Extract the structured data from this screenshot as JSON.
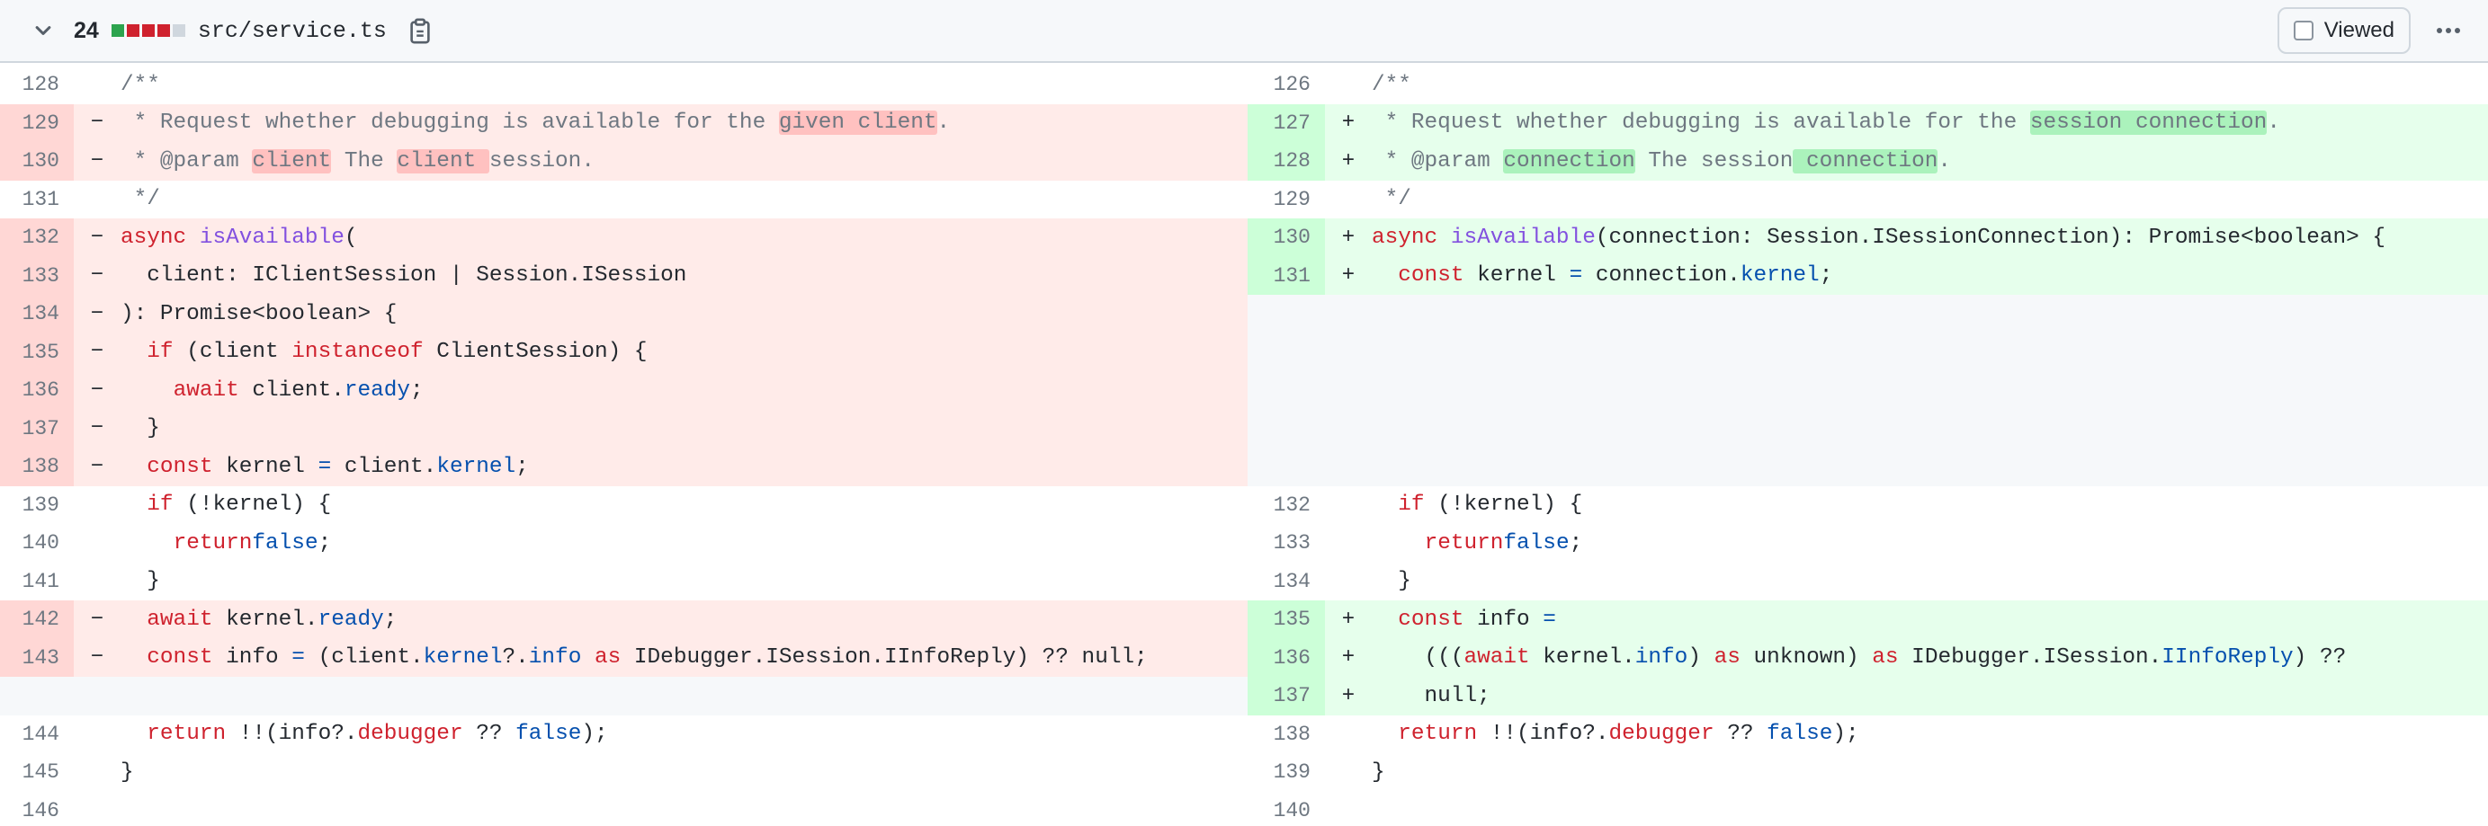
{
  "file": {
    "changes": "24",
    "name": "src/service.ts",
    "viewed_label": "Viewed",
    "blocks": [
      "#2da44e",
      "#cf222e",
      "#cf222e",
      "#cf222e",
      "#d0d7de"
    ]
  },
  "left": [
    {
      "n": "128",
      "t": "ctx",
      "s": [
        [
          "c",
          "/**"
        ]
      ]
    },
    {
      "n": "129",
      "t": "del",
      "m": "−",
      "s": [
        [
          "c",
          " * Request whether debugging is available for the "
        ],
        [
          "cd",
          "given client"
        ],
        [
          "c",
          "."
        ]
      ]
    },
    {
      "n": "130",
      "t": "del",
      "m": "−",
      "s": [
        [
          "c",
          " * @param "
        ],
        [
          "cd",
          "client"
        ],
        [
          "c",
          " The "
        ],
        [
          "cd",
          "client "
        ],
        [
          "c",
          "session."
        ]
      ]
    },
    {
      "n": "131",
      "t": "ctx",
      "s": [
        [
          "c",
          " */"
        ]
      ]
    },
    {
      "n": "132",
      "t": "del",
      "m": "−",
      "s": [
        [
          "k",
          "async "
        ],
        [
          "f",
          "isAvailable"
        ],
        [
          "",
          "("
        ]
      ]
    },
    {
      "n": "133",
      "t": "del",
      "m": "−",
      "s": [
        [
          "",
          "  client: IClientSession | Session.ISession"
        ]
      ]
    },
    {
      "n": "134",
      "t": "del",
      "m": "−",
      "s": [
        [
          "",
          "): Promise<boolean> {"
        ]
      ]
    },
    {
      "n": "135",
      "t": "del",
      "m": "−",
      "s": [
        [
          "",
          "  "
        ],
        [
          "k",
          "if"
        ],
        [
          "",
          " (client "
        ],
        [
          "k",
          "instanceof"
        ],
        [
          "",
          " ClientSession) {"
        ]
      ]
    },
    {
      "n": "136",
      "t": "del",
      "m": "−",
      "s": [
        [
          "",
          "    "
        ],
        [
          "k",
          "await"
        ],
        [
          "",
          " client."
        ],
        [
          "p",
          "ready"
        ],
        [
          "",
          ";"
        ]
      ]
    },
    {
      "n": "137",
      "t": "del",
      "m": "−",
      "s": [
        [
          "",
          "  }"
        ]
      ]
    },
    {
      "n": "138",
      "t": "del",
      "m": "−",
      "s": [
        [
          "",
          "  "
        ],
        [
          "k",
          "const"
        ],
        [
          "",
          " kernel "
        ],
        [
          "p",
          "="
        ],
        [
          "",
          " client."
        ],
        [
          "p",
          "kernel"
        ],
        [
          "",
          ";"
        ]
      ]
    },
    {
      "n": "139",
      "t": "ctx",
      "s": [
        [
          "",
          "  "
        ],
        [
          "k",
          "if"
        ],
        [
          "",
          " (!kernel) {"
        ]
      ]
    },
    {
      "n": "140",
      "t": "ctx",
      "s": [
        [
          "",
          "    "
        ],
        [
          "k",
          "return"
        ],
        [
          " ",
          ""
        ],
        [
          "p",
          "false"
        ],
        [
          "",
          ";"
        ]
      ]
    },
    {
      "n": "141",
      "t": "ctx",
      "s": [
        [
          "",
          "  }"
        ]
      ]
    },
    {
      "n": "142",
      "t": "del",
      "m": "−",
      "s": [
        [
          "",
          "  "
        ],
        [
          "k",
          "await"
        ],
        [
          "",
          " kernel."
        ],
        [
          "p",
          "ready"
        ],
        [
          "",
          ";"
        ]
      ]
    },
    {
      "n": "143",
      "t": "del",
      "m": "−",
      "s": [
        [
          "",
          "  "
        ],
        [
          "k",
          "const"
        ],
        [
          "",
          " info "
        ],
        [
          "p",
          "="
        ],
        [
          "",
          " (client."
        ],
        [
          "p",
          "kernel"
        ],
        [
          "",
          "?."
        ],
        [
          "p",
          "info"
        ],
        [
          "k",
          " as"
        ],
        [
          "",
          " IDebugger.ISession.IInfoReply) ?? null;"
        ]
      ]
    },
    {
      "n": "",
      "t": "empty",
      "s": []
    },
    {
      "n": "144",
      "t": "ctx",
      "s": [
        [
          "",
          "  "
        ],
        [
          "k",
          "return"
        ],
        [
          "",
          " !!(info?."
        ],
        [
          "k",
          "debugger"
        ],
        [
          "",
          " ?? "
        ],
        [
          "p",
          "false"
        ],
        [
          "",
          ");"
        ]
      ]
    },
    {
      "n": "145",
      "t": "ctx",
      "s": [
        [
          "",
          "}"
        ]
      ]
    },
    {
      "n": "146",
      "t": "ctx",
      "s": []
    }
  ],
  "right": [
    {
      "n": "126",
      "t": "ctx",
      "s": [
        [
          "c",
          "/**"
        ]
      ]
    },
    {
      "n": "127",
      "t": "add",
      "m": "+",
      "s": [
        [
          "c",
          " * Request whether debugging is available for the "
        ],
        [
          "ca",
          "session connection"
        ],
        [
          "c",
          "."
        ]
      ]
    },
    {
      "n": "128",
      "t": "add",
      "m": "+",
      "s": [
        [
          "c",
          " * @param "
        ],
        [
          "ca",
          "connection"
        ],
        [
          "c",
          " The session"
        ],
        [
          "ca",
          " connection"
        ],
        [
          "c",
          "."
        ]
      ]
    },
    {
      "n": "129",
      "t": "ctx",
      "s": [
        [
          "c",
          " */"
        ]
      ]
    },
    {
      "n": "130",
      "t": "add",
      "m": "+",
      "s": [
        [
          "k",
          "async "
        ],
        [
          "f",
          "isAvailable"
        ],
        [
          "",
          "(connection: Session.ISessionConnection): Promise<boolean> {"
        ]
      ]
    },
    {
      "n": "131",
      "t": "add",
      "m": "+",
      "s": [
        [
          "",
          "  "
        ],
        [
          "k",
          "const"
        ],
        [
          "",
          " kernel "
        ],
        [
          "p",
          "="
        ],
        [
          "",
          " connection."
        ],
        [
          "p",
          "kernel"
        ],
        [
          "",
          ";"
        ]
      ]
    },
    {
      "n": "",
      "t": "empty",
      "s": []
    },
    {
      "n": "",
      "t": "empty",
      "s": []
    },
    {
      "n": "",
      "t": "empty",
      "s": []
    },
    {
      "n": "",
      "t": "empty",
      "s": []
    },
    {
      "n": "",
      "t": "empty",
      "s": []
    },
    {
      "n": "132",
      "t": "ctx",
      "s": [
        [
          "",
          "  "
        ],
        [
          "k",
          "if"
        ],
        [
          "",
          " (!kernel) {"
        ]
      ]
    },
    {
      "n": "133",
      "t": "ctx",
      "s": [
        [
          "",
          "    "
        ],
        [
          "k",
          "return"
        ],
        [
          " ",
          ""
        ],
        [
          "p",
          "false"
        ],
        [
          "",
          ";"
        ]
      ]
    },
    {
      "n": "134",
      "t": "ctx",
      "s": [
        [
          "",
          "  }"
        ]
      ]
    },
    {
      "n": "135",
      "t": "add",
      "m": "+",
      "s": [
        [
          "",
          "  "
        ],
        [
          "k",
          "const"
        ],
        [
          "",
          " info "
        ],
        [
          "p",
          "="
        ]
      ]
    },
    {
      "n": "136",
      "t": "add",
      "m": "+",
      "s": [
        [
          "",
          "    ((("
        ],
        [
          "k",
          "await"
        ],
        [
          "",
          " kernel."
        ],
        [
          "p",
          "info"
        ],
        [
          "",
          ") "
        ],
        [
          "k",
          "as"
        ],
        [
          "",
          " unknown) "
        ],
        [
          "k",
          "as"
        ],
        [
          "",
          " IDebugger.ISession."
        ],
        [
          "p",
          "IInfoReply"
        ],
        [
          "",
          ") ??"
        ]
      ]
    },
    {
      "n": "137",
      "t": "add",
      "m": "+",
      "s": [
        [
          "",
          "    null;"
        ]
      ]
    },
    {
      "n": "138",
      "t": "ctx",
      "s": [
        [
          "",
          "  "
        ],
        [
          "k",
          "return"
        ],
        [
          "",
          " !!(info?."
        ],
        [
          "k",
          "debugger"
        ],
        [
          "",
          " ?? "
        ],
        [
          "p",
          "false"
        ],
        [
          "",
          ");"
        ]
      ]
    },
    {
      "n": "139",
      "t": "ctx",
      "s": [
        [
          "",
          "}"
        ]
      ]
    },
    {
      "n": "140",
      "t": "ctx",
      "s": []
    }
  ]
}
